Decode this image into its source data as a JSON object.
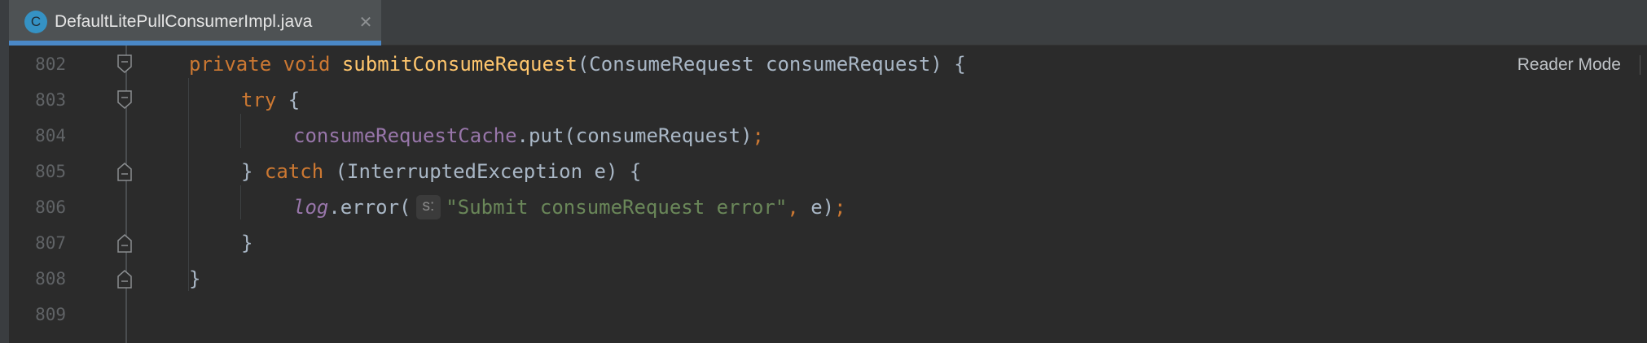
{
  "tab": {
    "icon_letter": "C",
    "icon_name": "class-icon",
    "title": "DefaultLitePullConsumerImpl.java",
    "close_glyph": "✕",
    "accent_color": "#4a88c7"
  },
  "editor": {
    "reader_mode_label": "Reader Mode",
    "line_numbers": [
      "802",
      "803",
      "804",
      "805",
      "806",
      "807",
      "808",
      "809"
    ],
    "lines": {
      "l802": {
        "kw_private": "private",
        "kw_void": "void",
        "method": "submitConsumeRequest",
        "rest": "(ConsumeRequest consumeRequest) {"
      },
      "l803": {
        "kw_try": "try",
        "rest": " {"
      },
      "l804": {
        "field": "consumeRequestCache",
        "call": ".put(consumeRequest)",
        "semi": ";"
      },
      "l805": {
        "brace": "} ",
        "kw_catch": "catch",
        "rest": " (InterruptedException e) {"
      },
      "l806": {
        "field": "log",
        "call": ".error(",
        "hint": "s:",
        "string": "\"Submit consumeRequest error\"",
        "comma": ",",
        "arg": " e)",
        "semi": ";"
      },
      "l807": {
        "brace": "}"
      },
      "l808": {
        "brace": "}"
      }
    },
    "colors": {
      "keyword": "#cc7832",
      "method": "#ffc66d",
      "field": "#9876aa",
      "string": "#6a8759",
      "text": "#a9b7c6",
      "background": "#2b2b2b"
    }
  }
}
